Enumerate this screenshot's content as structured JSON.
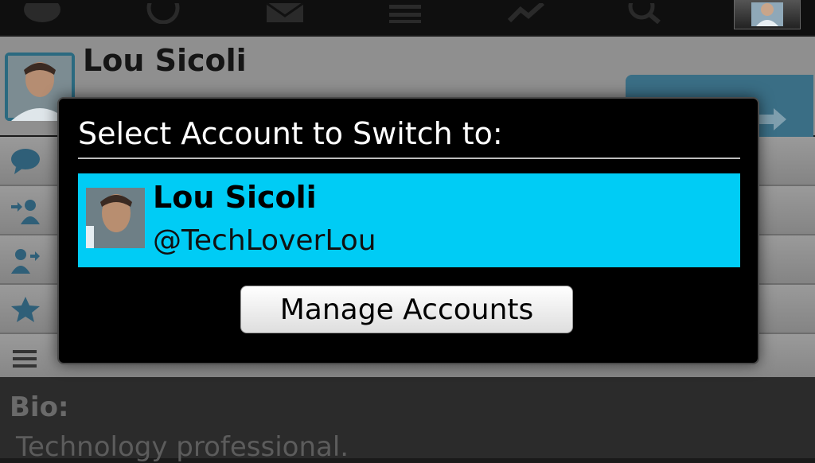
{
  "top_toolbar": {
    "icons": [
      "speech-bubble-icon",
      "at-sign-icon",
      "envelope-icon",
      "list-icon",
      "trending-icon",
      "search-icon"
    ],
    "account_avatar": "avatar-icon"
  },
  "profile": {
    "name": "Lou Sicoli",
    "actions": [
      "pencil-icon",
      "switch-arrows-icon"
    ]
  },
  "list_rows": [
    {
      "icon": "speech-bubble-icon"
    },
    {
      "icon": "followers-icon"
    },
    {
      "icon": "following-icon"
    },
    {
      "icon": "star-icon"
    },
    {
      "icon": "list-icon"
    }
  ],
  "bio": {
    "label": "Bio:",
    "text": "Technology professional."
  },
  "dialog": {
    "title": "Select Account to Switch to:",
    "accounts": [
      {
        "name": "Lou Sicoli",
        "handle": "@TechLoverLou",
        "selected": true
      }
    ],
    "manage_button": "Manage Accounts"
  },
  "colors": {
    "selection": "#00ccf5",
    "dialog_bg": "#000000",
    "accent": "#3a6e85"
  }
}
